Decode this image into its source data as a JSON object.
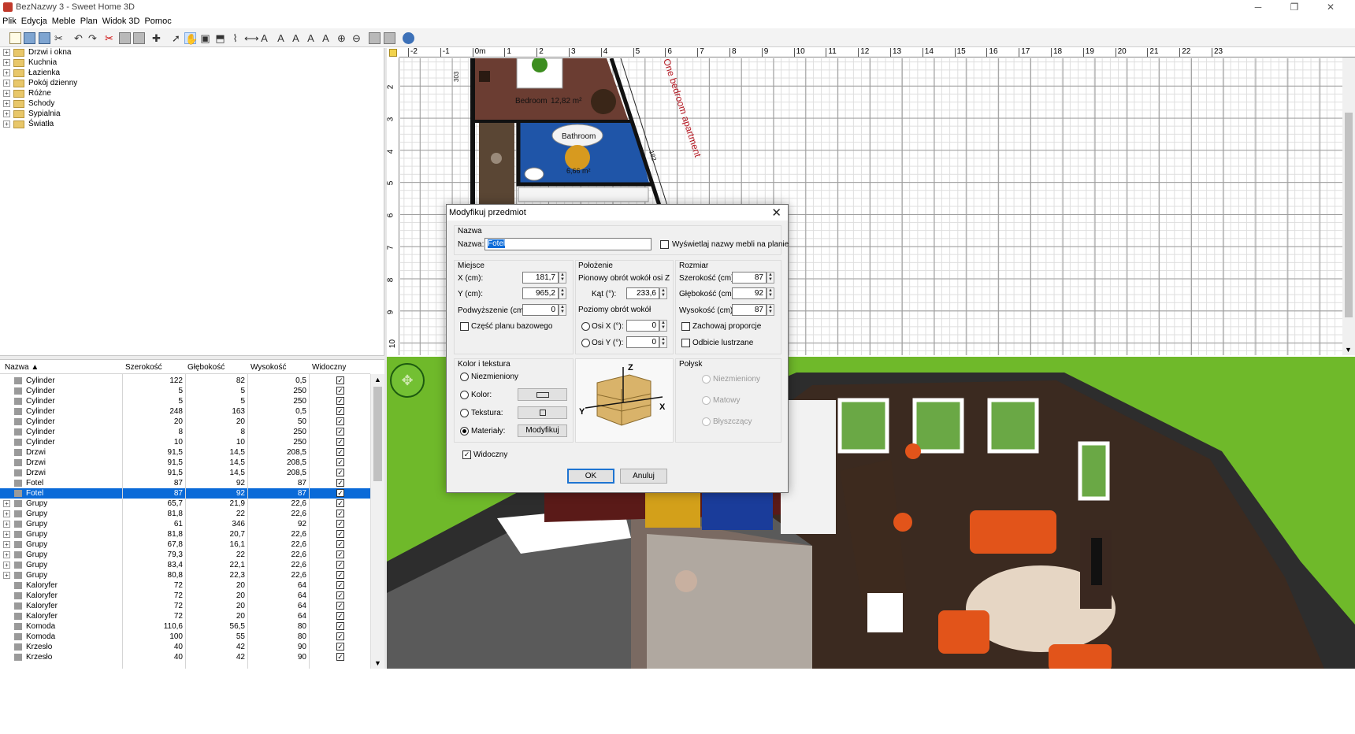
{
  "window": {
    "title": "BezNazwy 3 - Sweet Home 3D"
  },
  "menu": [
    "Plik",
    "Edycja",
    "Meble",
    "Plan",
    "Widok 3D",
    "Pomoc"
  ],
  "catalog": [
    "Drzwi i okna",
    "Kuchnia",
    "Łazienka",
    "Pokój dzienny",
    "Różne",
    "Schody",
    "Sypialnia",
    "Światła"
  ],
  "table": {
    "columns": [
      "Nazwa ▲",
      "Szerokość",
      "Głębokość",
      "Wysokość",
      "Widoczny"
    ],
    "rows": [
      {
        "name": "Cylinder",
        "w": "122",
        "d": "82",
        "h": "0,5",
        "group": false,
        "selected": false
      },
      {
        "name": "Cylinder",
        "w": "5",
        "d": "5",
        "h": "250",
        "group": false,
        "selected": false
      },
      {
        "name": "Cylinder",
        "w": "5",
        "d": "5",
        "h": "250",
        "group": false,
        "selected": false
      },
      {
        "name": "Cylinder",
        "w": "248",
        "d": "163",
        "h": "0,5",
        "group": false,
        "selected": false
      },
      {
        "name": "Cylinder",
        "w": "20",
        "d": "20",
        "h": "50",
        "group": false,
        "selected": false
      },
      {
        "name": "Cylinder",
        "w": "8",
        "d": "8",
        "h": "250",
        "group": false,
        "selected": false
      },
      {
        "name": "Cylinder",
        "w": "10",
        "d": "10",
        "h": "250",
        "group": false,
        "selected": false
      },
      {
        "name": "Drzwi",
        "w": "91,5",
        "d": "14,5",
        "h": "208,5",
        "group": false,
        "selected": false
      },
      {
        "name": "Drzwi",
        "w": "91,5",
        "d": "14,5",
        "h": "208,5",
        "group": false,
        "selected": false
      },
      {
        "name": "Drzwi",
        "w": "91,5",
        "d": "14,5",
        "h": "208,5",
        "group": false,
        "selected": false
      },
      {
        "name": "Fotel",
        "w": "87",
        "d": "92",
        "h": "87",
        "group": false,
        "selected": false
      },
      {
        "name": "Fotel",
        "w": "87",
        "d": "92",
        "h": "87",
        "group": false,
        "selected": true
      },
      {
        "name": "Grupy",
        "w": "65,7",
        "d": "21,9",
        "h": "22,6",
        "group": true,
        "selected": false
      },
      {
        "name": "Grupy",
        "w": "81,8",
        "d": "22",
        "h": "22,6",
        "group": true,
        "selected": false
      },
      {
        "name": "Grupy",
        "w": "61",
        "d": "346",
        "h": "92",
        "group": true,
        "selected": false
      },
      {
        "name": "Grupy",
        "w": "81,8",
        "d": "20,7",
        "h": "22,6",
        "group": true,
        "selected": false
      },
      {
        "name": "Grupy",
        "w": "67,8",
        "d": "16,1",
        "h": "22,6",
        "group": true,
        "selected": false
      },
      {
        "name": "Grupy",
        "w": "79,3",
        "d": "22",
        "h": "22,6",
        "group": true,
        "selected": false
      },
      {
        "name": "Grupy",
        "w": "83,4",
        "d": "22,1",
        "h": "22,6",
        "group": true,
        "selected": false
      },
      {
        "name": "Grupy",
        "w": "80,8",
        "d": "22,3",
        "h": "22,6",
        "group": true,
        "selected": false
      },
      {
        "name": "Kaloryfer",
        "w": "72",
        "d": "20",
        "h": "64",
        "group": false,
        "selected": false
      },
      {
        "name": "Kaloryfer",
        "w": "72",
        "d": "20",
        "h": "64",
        "group": false,
        "selected": false
      },
      {
        "name": "Kaloryfer",
        "w": "72",
        "d": "20",
        "h": "64",
        "group": false,
        "selected": false
      },
      {
        "name": "Kaloryfer",
        "w": "72",
        "d": "20",
        "h": "64",
        "group": false,
        "selected": false
      },
      {
        "name": "Komoda",
        "w": "110,6",
        "d": "56,5",
        "h": "80",
        "group": false,
        "selected": false
      },
      {
        "name": "Komoda",
        "w": "100",
        "d": "55",
        "h": "80",
        "group": false,
        "selected": false
      },
      {
        "name": "Krzesło",
        "w": "40",
        "d": "42",
        "h": "90",
        "group": false,
        "selected": false
      },
      {
        "name": "Krzesło",
        "w": "40",
        "d": "42",
        "h": "90",
        "group": false,
        "selected": false
      }
    ]
  },
  "plan": {
    "ruler_x": [
      "-2",
      "-1",
      "0m",
      "1",
      "2",
      "3",
      "4",
      "5",
      "6",
      "7",
      "8",
      "9",
      "10",
      "11",
      "12",
      "13",
      "14",
      "15",
      "16",
      "17",
      "18",
      "19",
      "20",
      "21",
      "22",
      "23"
    ],
    "ruler_y": [
      "2",
      "3",
      "4",
      "5",
      "6",
      "7",
      "8",
      "9",
      "10"
    ],
    "bedroom_label": "Bedroom",
    "bedroom_area": "12,82 m²",
    "bathroom_label": "Bathroom",
    "bathroom_area": "6,66 m²",
    "apartment_label": "One bedroom apartment",
    "dim_303": "303",
    "dim_182": "182"
  },
  "dialog": {
    "title": "Modyfikuj przedmiot",
    "name_group": "Nazwa",
    "name_label": "Nazwa:",
    "name_value": "Fotel",
    "show_names_label": "Wyświetlaj nazwy mebli na planie",
    "place_group": "Miejsce",
    "x_label": "X (cm):",
    "x_value": "181,7",
    "y_label": "Y (cm):",
    "y_value": "965,2",
    "elev_label": "Podwyższenie (cm):",
    "elev_value": "0",
    "base_plan_label": "Część planu bazowego",
    "orient_group": "Położenie",
    "vert_rot_label": "Pionowy obrót wokół osi Z",
    "angle_label": "Kąt (°):",
    "angle_value": "233,6",
    "horiz_rot_label": "Poziomy obrót wokół",
    "axis_x_label": "Osi X (°):",
    "axis_x_value": "0",
    "axis_y_label": "Osi Y (°):",
    "axis_y_value": "0",
    "size_group": "Rozmiar",
    "width_label": "Szerokość (cm):",
    "width_value": "87",
    "depth_label": "Głębokość (cm):",
    "depth_value": "92",
    "height_label": "Wysokość (cm):",
    "height_value": "87",
    "keep_prop_label": "Zachowaj proporcje",
    "mirror_label": "Odbicie lustrzane",
    "color_group": "Kolor i tekstura",
    "unchanged_label": "Niezmieniony",
    "color_label": "Kolor:",
    "texture_label": "Tekstura:",
    "materials_label": "Materiały:",
    "modify_button": "Modyfikuj",
    "shine_group": "Połysk",
    "shine_unchanged": "Niezmieniony",
    "shine_matte": "Matowy",
    "shine_glossy": "Błyszczący",
    "visible_label": "Widoczny",
    "ok": "OK",
    "cancel": "Anuluj",
    "axis_z": "Z",
    "axis_xl": "X",
    "axis_yl": "Y"
  },
  "colors": {
    "selection": "#0a6ad8",
    "grass": "#6fb92a",
    "sofa": "#e2541a",
    "floor_dark": "#3b2a20"
  }
}
